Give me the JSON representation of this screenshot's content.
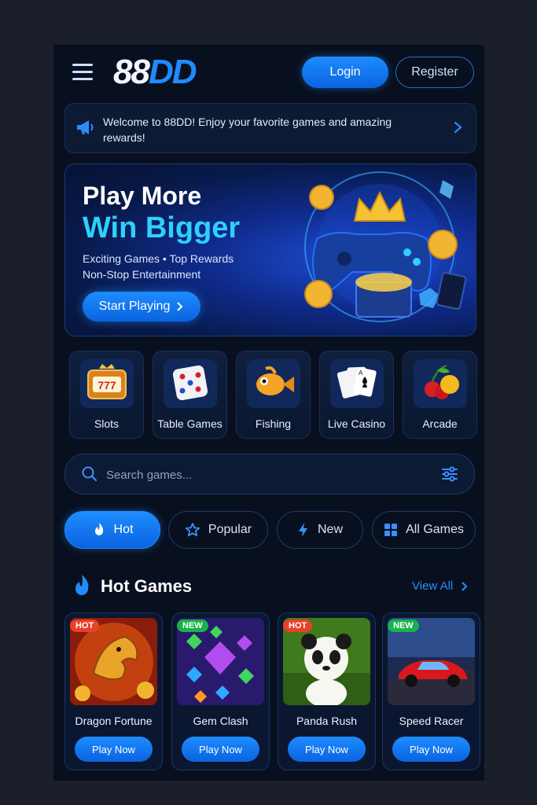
{
  "header": {
    "logo_part1": "88",
    "logo_part2": "DD",
    "login_label": "Login",
    "register_label": "Register"
  },
  "announcement": {
    "text": "Welcome to 88DD! Enjoy your favorite games and amazing rewards!"
  },
  "hero": {
    "title_line1": "Play More",
    "title_line2": "Win Bigger",
    "subtitle_line1": "Exciting Games  •  Top Rewards",
    "subtitle_line2": "Non-Stop Entertainment",
    "cta_label": "Start Playing"
  },
  "categories": [
    {
      "label": "Slots",
      "icon": "slot-machine-icon"
    },
    {
      "label": "Table Games",
      "icon": "dice-icon"
    },
    {
      "label": "Fishing",
      "icon": "fish-icon"
    },
    {
      "label": "Live Casino",
      "icon": "playing-cards-icon"
    },
    {
      "label": "Arcade",
      "icon": "fruits-icon"
    }
  ],
  "search": {
    "placeholder": "Search games..."
  },
  "tabs": [
    {
      "label": "Hot",
      "icon": "fire-icon",
      "active": true
    },
    {
      "label": "Popular",
      "icon": "star-icon",
      "active": false
    },
    {
      "label": "New",
      "icon": "lightning-icon",
      "active": false
    },
    {
      "label": "All Games",
      "icon": "grid-icon",
      "active": false
    }
  ],
  "section": {
    "title": "Hot Games",
    "view_all_label": "View All"
  },
  "games": [
    {
      "name": "Dragon Fortune",
      "badge": "HOT",
      "play_label": "Play Now"
    },
    {
      "name": "Gem Clash",
      "badge": "NEW",
      "play_label": "Play Now"
    },
    {
      "name": "Panda Rush",
      "badge": "HOT",
      "play_label": "Play Now"
    },
    {
      "name": "Speed Racer",
      "badge": "NEW",
      "play_label": "Play Now"
    }
  ],
  "colors": {
    "accent": "#1e8cff",
    "background": "#08101f",
    "hot_badge": "#e8402a",
    "new_badge": "#19b24a",
    "hero_highlight": "#2fd0ff"
  }
}
